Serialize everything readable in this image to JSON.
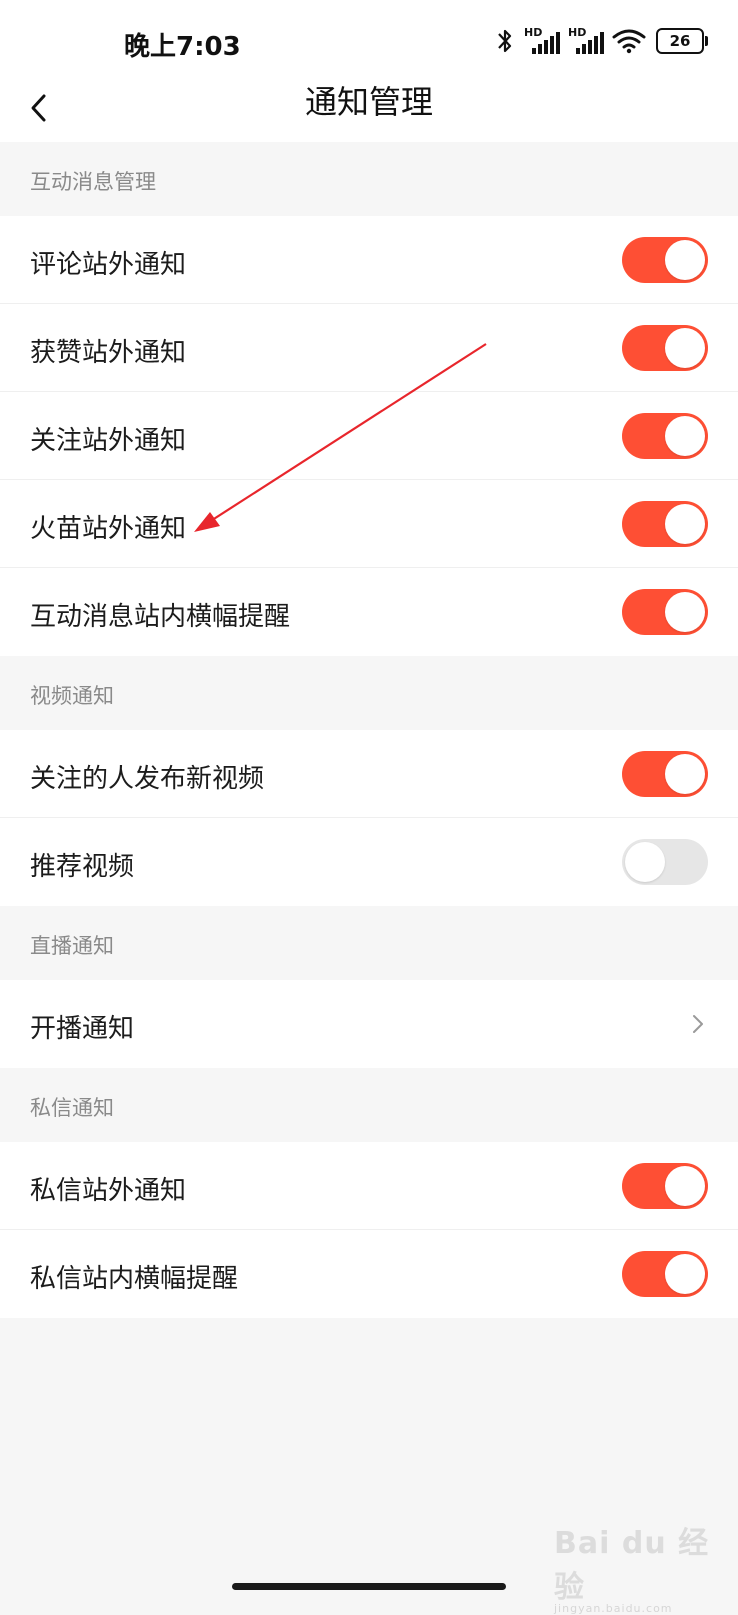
{
  "status_bar": {
    "time": "晚上7:03",
    "hd_label": "HD",
    "battery": "26"
  },
  "nav": {
    "title": "通知管理"
  },
  "sections": [
    {
      "header": "互动消息管理",
      "items": [
        {
          "label": "评论站外通知",
          "type": "toggle",
          "on": true
        },
        {
          "label": "获赞站外通知",
          "type": "toggle",
          "on": true
        },
        {
          "label": "关注站外通知",
          "type": "toggle",
          "on": true
        },
        {
          "label": "火苗站外通知",
          "type": "toggle",
          "on": true
        },
        {
          "label": "互动消息站内横幅提醒",
          "type": "toggle",
          "on": true
        }
      ]
    },
    {
      "header": "视频通知",
      "items": [
        {
          "label": "关注的人发布新视频",
          "type": "toggle",
          "on": true
        },
        {
          "label": "推荐视频",
          "type": "toggle",
          "on": false
        }
      ]
    },
    {
      "header": "直播通知",
      "items": [
        {
          "label": "开播通知",
          "type": "link"
        }
      ]
    },
    {
      "header": "私信通知",
      "items": [
        {
          "label": "私信站外通知",
          "type": "toggle",
          "on": true
        },
        {
          "label": "私信站内横幅提醒",
          "type": "toggle",
          "on": true
        }
      ]
    }
  ],
  "colors": {
    "toggle_on": "#fe4f34",
    "toggle_off": "#e6e6e6",
    "annotation_arrow": "#e8262c"
  },
  "watermark": {
    "brand": "Bai du 经验",
    "domain": "jingyan.baidu.com"
  }
}
